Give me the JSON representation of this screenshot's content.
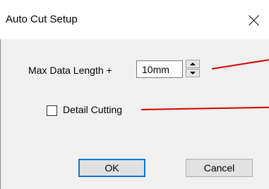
{
  "window": {
    "title": "Auto Cut Setup"
  },
  "max_data_length": {
    "label": "Max Data Length +",
    "value": "10mm"
  },
  "detail_cutting": {
    "label": "Detail Cutting",
    "checked": false
  },
  "buttons": {
    "ok": "OK",
    "cancel": "Cancel"
  },
  "colors": {
    "annotation_line": "#d40000",
    "focus_border": "#0078d7"
  }
}
